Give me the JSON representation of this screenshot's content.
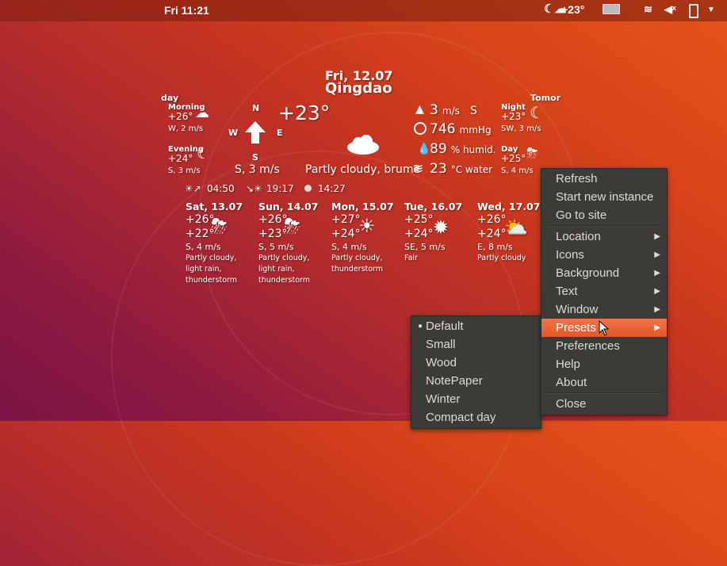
{
  "topbar": {
    "clock": "Fri 11:21",
    "weather_indicator": "+23°",
    "icons": [
      "weather-night-cloud-icon",
      "keyboard-icon",
      "wifi-icon",
      "volume-muted-icon",
      "battery-icon",
      "chevron-down-icon"
    ]
  },
  "widget": {
    "date": "Fri, 12.07",
    "city": "Qingdao",
    "today_label": "day",
    "tomorrow_label": "Tomor",
    "morning": {
      "label": "Morning",
      "temp": "+26°",
      "wind": "W, 2 m/s"
    },
    "evening": {
      "label": "Evening",
      "temp": "+24°",
      "wind": "S, 3 m/s"
    },
    "night": {
      "label": "Night",
      "temp": "+23°",
      "wind": "SW, 3 m/s"
    },
    "day": {
      "label": "Day",
      "temp": "+25°",
      "wind": "S, 4 m/s"
    },
    "compass": {
      "n": "N",
      "s": "S",
      "e": "E",
      "w": "W"
    },
    "wind_summary": "S, 3 m/s",
    "current_temp": "+23°",
    "condition": "Partly cloudy, brume",
    "wind_speed": "3",
    "wind_unit": "m/s",
    "wind_dir": "S",
    "pressure": "746",
    "pressure_unit": "mmHg",
    "humidity": "89",
    "humidity_unit": "% humid.",
    "water_temp": "23",
    "water_unit": "°C water",
    "sunrise_icon": "☀↗",
    "sunrise": "04:50",
    "sunset_icon": "↘☀",
    "sunset": "19:17",
    "daylength": "14:27"
  },
  "forecast": [
    {
      "date": "Sat, 13.07",
      "high": "+26°",
      "low": "+22°",
      "wind": "S, 4 m/s",
      "cond": [
        "Partly cloudy,",
        "light rain,",
        "thunderstorm"
      ],
      "icon": "cloud-sun-rain-storm-icon"
    },
    {
      "date": "Sun, 14.07",
      "high": "+26°",
      "low": "+23°",
      "wind": "S, 5 m/s",
      "cond": [
        "Partly cloudy,",
        "light rain,",
        "thunderstorm"
      ],
      "icon": "cloud-sun-rain-storm-icon"
    },
    {
      "date": "Mon, 15.07",
      "high": "+27°",
      "low": "+24°",
      "wind": "S, 4 m/s",
      "cond": [
        "Partly cloudy,",
        "thunderstorm",
        ""
      ],
      "icon": "sun-fog-icon"
    },
    {
      "date": "Tue, 16.07",
      "high": "+25°",
      "low": "+24°",
      "wind": "SE, 5 m/s",
      "cond": [
        "Fair",
        "",
        ""
      ],
      "icon": "sun-icon"
    },
    {
      "date": "Wed, 17.07",
      "high": "+26°",
      "low": "+24°",
      "wind": "E, 8 m/s",
      "cond": [
        "Partly cloudy",
        "",
        ""
      ],
      "icon": "sun-cloud-icon"
    }
  ],
  "context_menu": {
    "items": [
      {
        "label": "Refresh"
      },
      {
        "label": "Start new instance"
      },
      {
        "label": "Go to site"
      },
      {
        "label": "Location",
        "submenu": true
      },
      {
        "label": "Icons",
        "submenu": true
      },
      {
        "label": "Background",
        "submenu": true
      },
      {
        "label": "Text",
        "submenu": true
      },
      {
        "label": "Window",
        "submenu": true
      },
      {
        "label": "Presets",
        "submenu": true,
        "highlighted": true
      },
      {
        "label": "Preferences"
      },
      {
        "label": "Help"
      },
      {
        "label": "About"
      },
      {
        "label": "Close"
      }
    ]
  },
  "presets_menu": {
    "selected": "Default",
    "items": [
      "Default",
      "Small",
      "Wood",
      "NotePaper",
      "Winter",
      "Compact day"
    ]
  },
  "colors": {
    "menu_bg": "#3c3b37",
    "menu_text": "#dfdbd2",
    "highlight": "#e95420"
  }
}
